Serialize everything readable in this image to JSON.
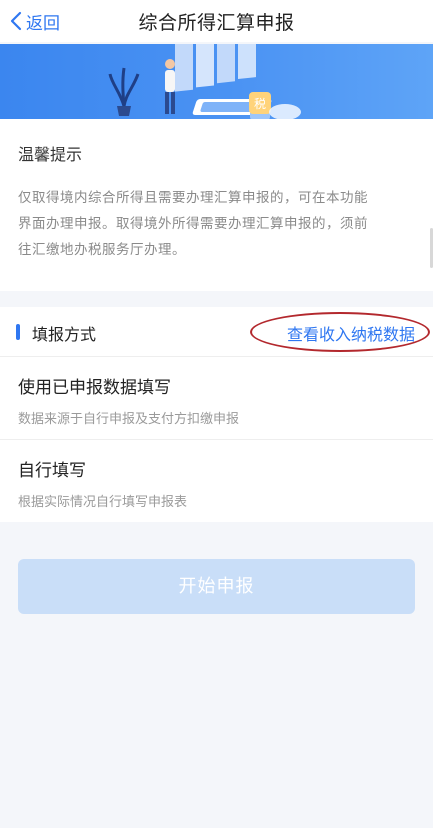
{
  "nav": {
    "back_label": "返回",
    "title": "综合所得汇算申报"
  },
  "banner": {
    "tax_char": "税",
    "arrows": "‹‹‹‹"
  },
  "notice": {
    "heading": "温馨提示",
    "body_lines": [
      "仅取得境内综合所得且需要办理汇算申报的，可在本功能",
      "界面办理申报。取得境外所得需要办理汇算申报的，须前",
      "往汇缴地办税服务厅办理。"
    ]
  },
  "method": {
    "label": "填报方式",
    "link": "查看收入纳税数据",
    "options": [
      {
        "title": "使用已申报数据填写",
        "subtitle": "数据来源于自行申报及支付方扣缴申报"
      },
      {
        "title": "自行填写",
        "subtitle": "根据实际情况自行填写申报表"
      }
    ]
  },
  "start_button": "开始申报",
  "colors": {
    "accent": "#2f77f1",
    "annotation_circle": "#b3282d",
    "disabled_button": "#c9def8"
  }
}
